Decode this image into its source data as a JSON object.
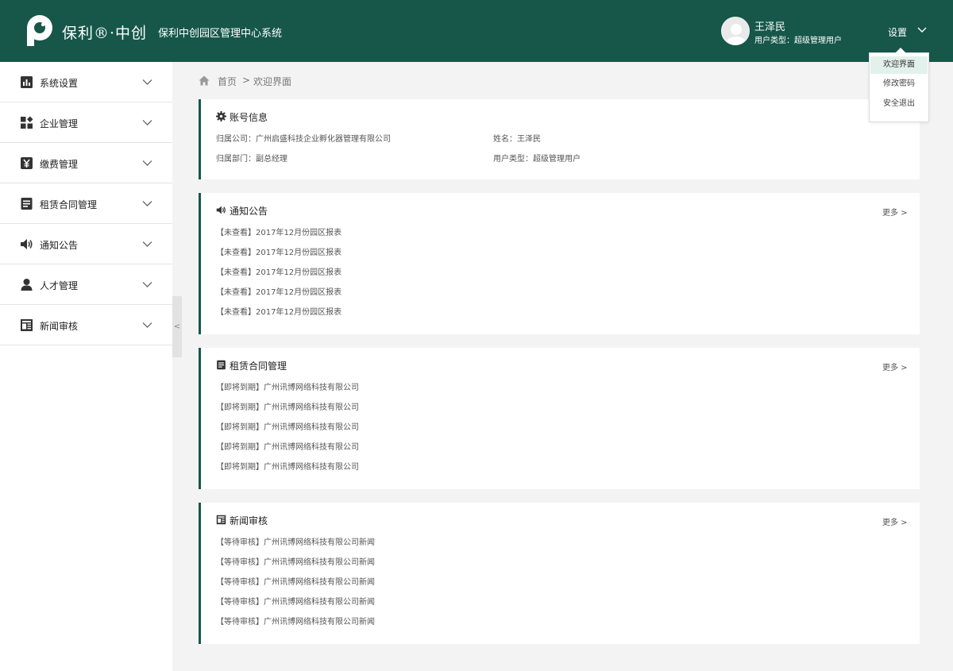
{
  "header": {
    "brand": "保利®·中创",
    "system_title": "保利中创园区管理中心系统",
    "user_name": "王泽民",
    "user_type": "用户类型：超级管理用户",
    "settings_label": "设置",
    "accent_color": "#16574a"
  },
  "dropdown": {
    "items": [
      "欢迎界面",
      "修改密码",
      "安全退出"
    ],
    "active_index": 0
  },
  "sidebar": {
    "items": [
      {
        "label": "系统设置",
        "icon": "bar-chart-icon"
      },
      {
        "label": "企业管理",
        "icon": "grid-icon"
      },
      {
        "label": "缴费管理",
        "icon": "yen-icon"
      },
      {
        "label": "租赁合同管理",
        "icon": "document-icon"
      },
      {
        "label": "通知公告",
        "icon": "speaker-icon"
      },
      {
        "label": "人才管理",
        "icon": "user-icon"
      },
      {
        "label": "新闻审核",
        "icon": "newspaper-icon"
      }
    ],
    "collapse_label": "<"
  },
  "breadcrumb": {
    "home": "首页",
    "separator": ">",
    "current": "欢迎界面"
  },
  "account": {
    "title": "账号信息",
    "company": "归属公司：广州启盛科技企业孵化器管理有限公司",
    "name": "姓名：王泽民",
    "department": "归属部门：副总经理",
    "user_type": "用户类型：超级管理用户"
  },
  "notices": {
    "title": "通知公告",
    "more": "更多 >",
    "items": [
      "【未查看】2017年12月份园区报表",
      "【未查看】2017年12月份园区报表",
      "【未查看】2017年12月份园区报表",
      "【未查看】2017年12月份园区报表",
      "【未查看】2017年12月份园区报表"
    ]
  },
  "contracts": {
    "title": "租赁合同管理",
    "more": "更多 >",
    "items": [
      "【即将到期】广州讯博网络科技有限公司",
      "【即将到期】广州讯博网络科技有限公司",
      "【即将到期】广州讯博网络科技有限公司",
      "【即将到期】广州讯博网络科技有限公司",
      "【即将到期】广州讯博网络科技有限公司"
    ]
  },
  "news": {
    "title": "新闻审核",
    "more": "更多 >",
    "items": [
      "【等待审核】广州讯博网络科技有限公司新闻",
      "【等待审核】广州讯博网络科技有限公司新闻",
      "【等待审核】广州讯博网络科技有限公司新闻",
      "【等待审核】广州讯博网络科技有限公司新闻",
      "【等待审核】广州讯博网络科技有限公司新闻"
    ]
  }
}
